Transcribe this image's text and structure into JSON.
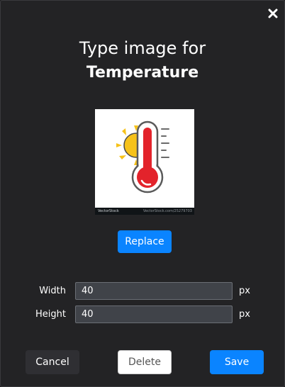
{
  "dialog": {
    "title_line1": "Type image for",
    "title_line2": "Temperature"
  },
  "preview": {
    "watermark_brand": "VectorStock",
    "watermark_ref": "VectorStock.com/25279703"
  },
  "buttons": {
    "replace": "Replace",
    "cancel": "Cancel",
    "delete": "Delete",
    "save": "Save"
  },
  "fields": {
    "width_label": "Width",
    "width_value": "40",
    "height_label": "Height",
    "height_value": "40",
    "unit": "px"
  },
  "colors": {
    "accent": "#0a84ff",
    "background": "#232325",
    "thermometer_red": "#e3232b",
    "sun_yellow": "#f6c21a"
  },
  "icons": {
    "close": "close-icon",
    "preview": "thermometer-sun-icon"
  }
}
